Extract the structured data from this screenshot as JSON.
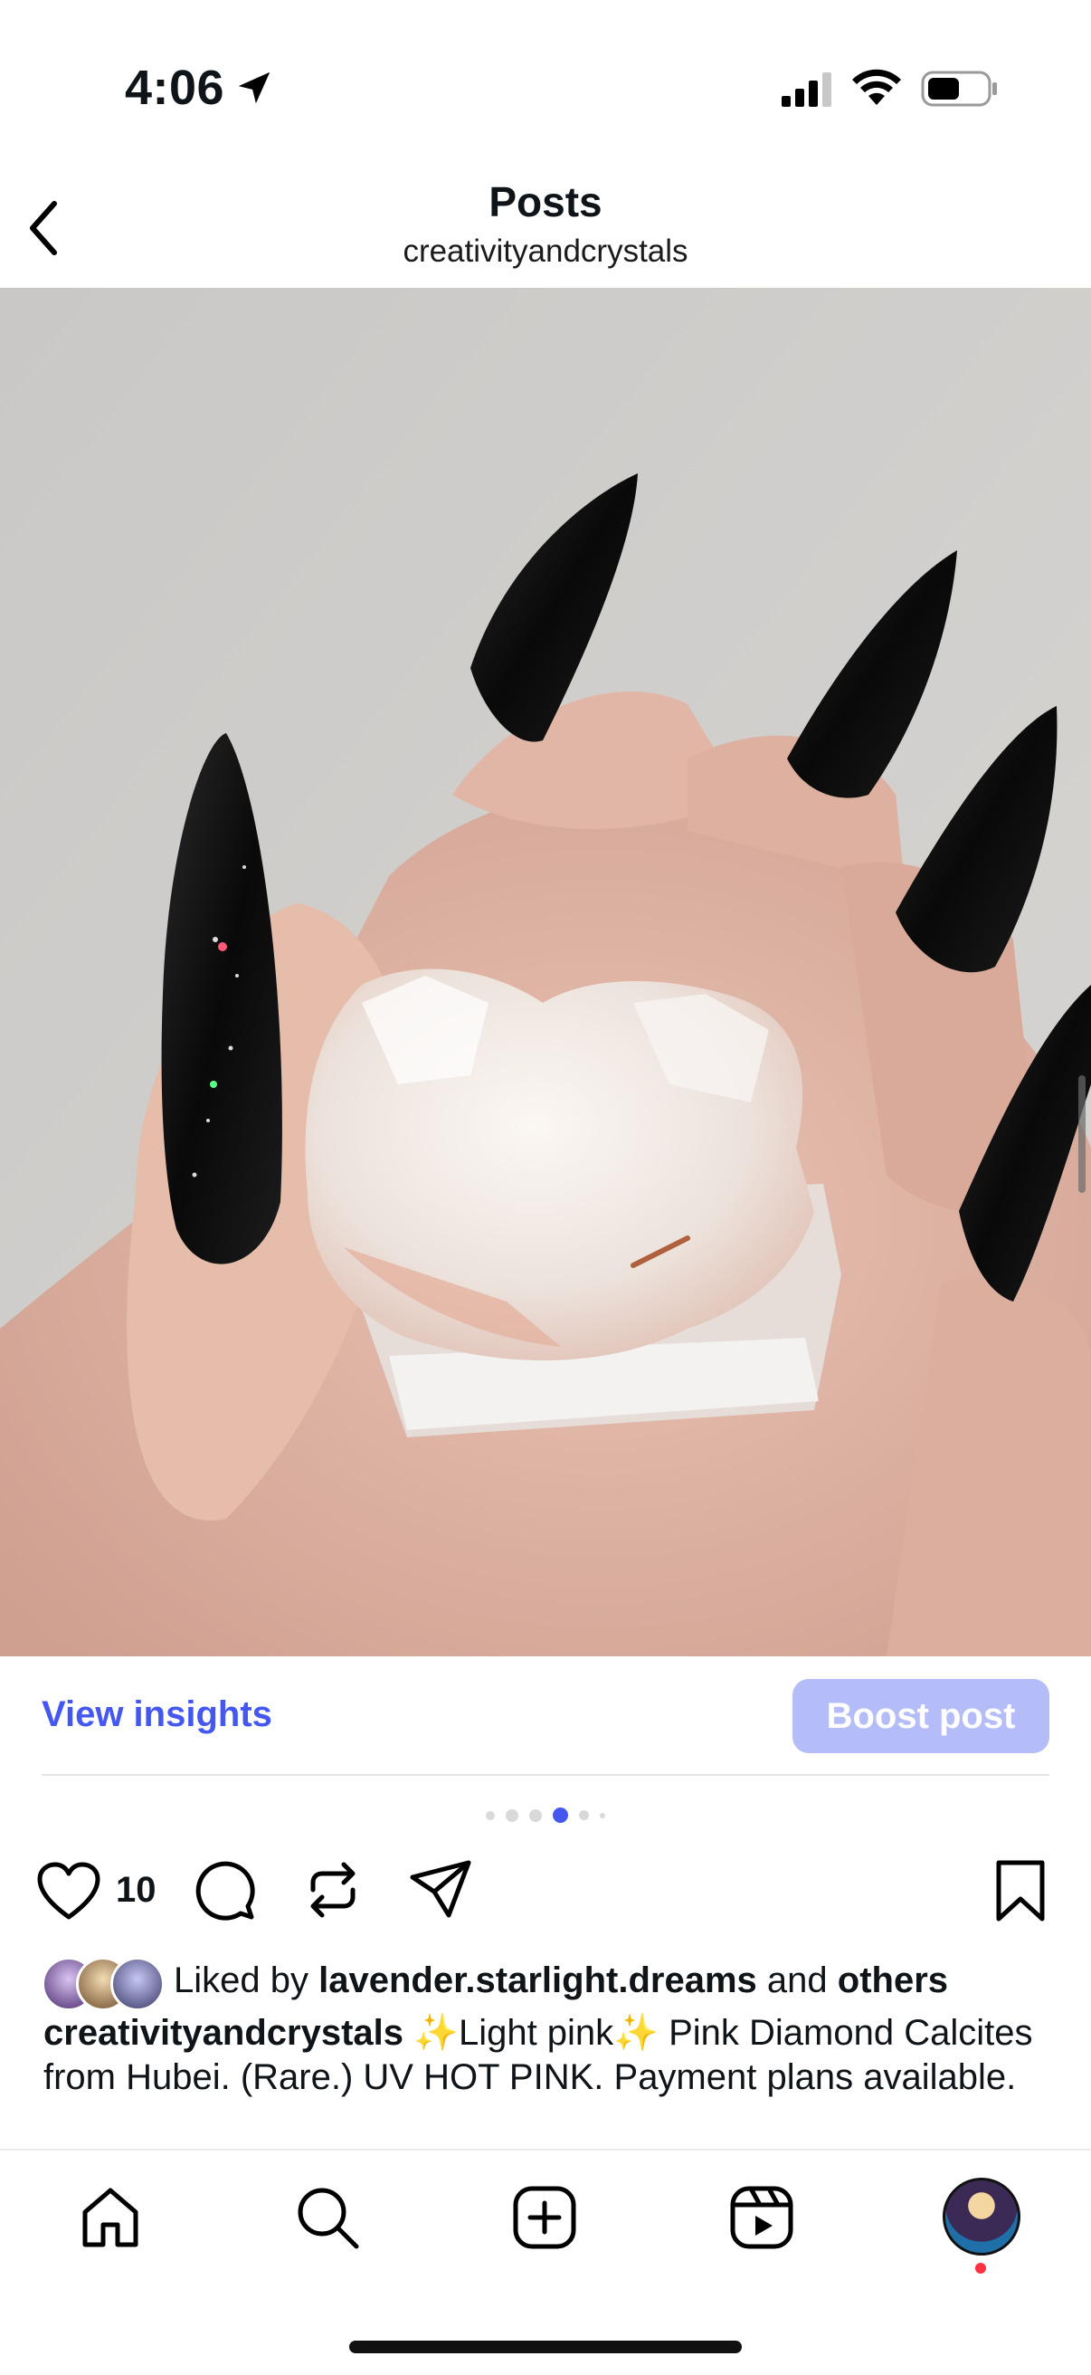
{
  "status_bar": {
    "time": "4:06"
  },
  "header": {
    "title": "Posts",
    "subtitle": "creativityandcrystals"
  },
  "post": {
    "view_insights_label": "View insights",
    "boost_label": "Boost post",
    "carousel": {
      "count": 6,
      "active_index": 3
    },
    "likes_count": "10",
    "liked_by_prefix": "Liked by",
    "liked_by_user": "lavender.starlight.dreams",
    "liked_by_and": "and",
    "liked_by_others": "others",
    "caption_user": "creativityandcrystals",
    "caption_text": "✨Light pink✨ Pink Diamond Calcites from Hubei. (Rare.) UV HOT PINK. Payment plans available."
  },
  "colors": {
    "accent": "#4458f0",
    "boost_bg": "#b4bdf7",
    "notification": "#ff3040"
  },
  "icons": [
    "location-arrow-icon",
    "signal-icon",
    "wifi-icon",
    "battery-icon",
    "back-chevron-icon",
    "heart-icon",
    "comment-icon",
    "repost-icon",
    "share-icon",
    "bookmark-icon",
    "home-icon",
    "search-icon",
    "create-icon",
    "reels-icon"
  ]
}
